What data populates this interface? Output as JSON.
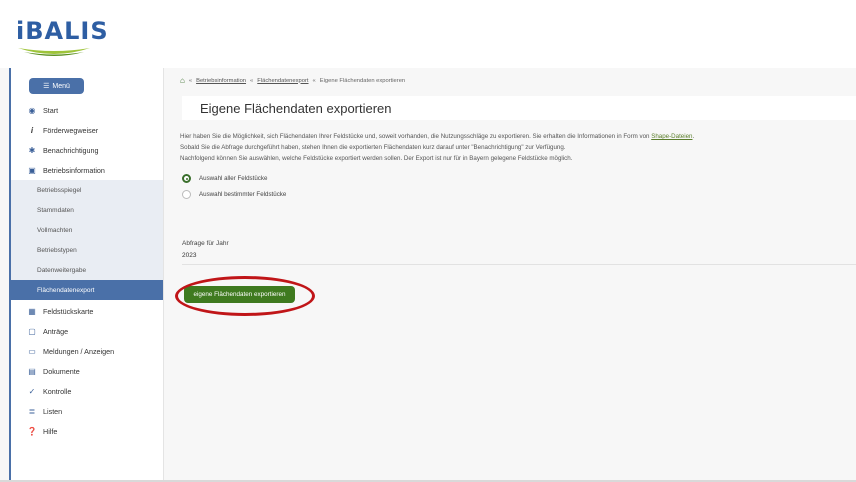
{
  "logo": {
    "text": "iBALIS"
  },
  "sidebar": {
    "menu_label": "Menü",
    "items": [
      {
        "label": "Start",
        "icon": "dashboard-icon"
      },
      {
        "label": "Förderwegweiser",
        "icon": "info-icon"
      },
      {
        "label": "Benachrichtigung",
        "icon": "bell-icon"
      },
      {
        "label": "Betriebsinformation",
        "icon": "building-icon"
      },
      {
        "label": "Betriebsspiegel",
        "sub": true
      },
      {
        "label": "Stammdaten",
        "sub": true
      },
      {
        "label": "Vollmachten",
        "sub": true
      },
      {
        "label": "Betriebstypen",
        "sub": true
      },
      {
        "label": "Datenweitergabe",
        "sub": true
      },
      {
        "label": "Flächendatenexport",
        "sub": true,
        "active": true
      },
      {
        "label": "Feldstückskarte",
        "icon": "map-icon"
      },
      {
        "label": "Anträge",
        "icon": "document-icon"
      },
      {
        "label": "Meldungen / Anzeigen",
        "icon": "monitor-icon"
      },
      {
        "label": "Dokumente",
        "icon": "file-icon"
      },
      {
        "label": "Kontrolle",
        "icon": "check-icon"
      },
      {
        "label": "Listen",
        "icon": "list-icon"
      },
      {
        "label": "Hilfe",
        "icon": "help-icon"
      }
    ]
  },
  "breadcrumb": {
    "items": [
      "Betriebsinformation",
      "Flächendatenexport",
      "Eigene Flächendaten exportieren"
    ]
  },
  "page": {
    "title": "Eigene Flächendaten exportieren",
    "para1": "Hier haben Sie die Möglichkeit, sich Flächendaten Ihrer Feldstücke und, soweit vorhanden, die Nutzungsschläge zu exportieren. Sie erhalten die Informationen in Form von ",
    "para1_link": "Shape-Dateien",
    "para1_end": ".",
    "para2": "Sobald Sie die Abfrage durchgeführt haben, stehen Ihnen die exportierten Flächendaten kurz darauf unter \"Benachrichtigung\" zur Verfügung.",
    "para3": "Nachfolgend können Sie auswählen, welche Feldstücke exportiert werden sollen. Der Export ist nur für in Bayern gelegene Feldstücke möglich.",
    "radio_all": "Auswahl aller Feldstücke",
    "radio_some": "Auswahl bestimmter Feldstücke",
    "year_label": "Abfrage für Jahr",
    "year_value": "2023",
    "export_button": "eigene Flächendaten exportieren"
  },
  "colors": {
    "brand_blue": "#4a70a8",
    "brand_green": "#3f7a1f",
    "highlight_red": "#c01518"
  }
}
